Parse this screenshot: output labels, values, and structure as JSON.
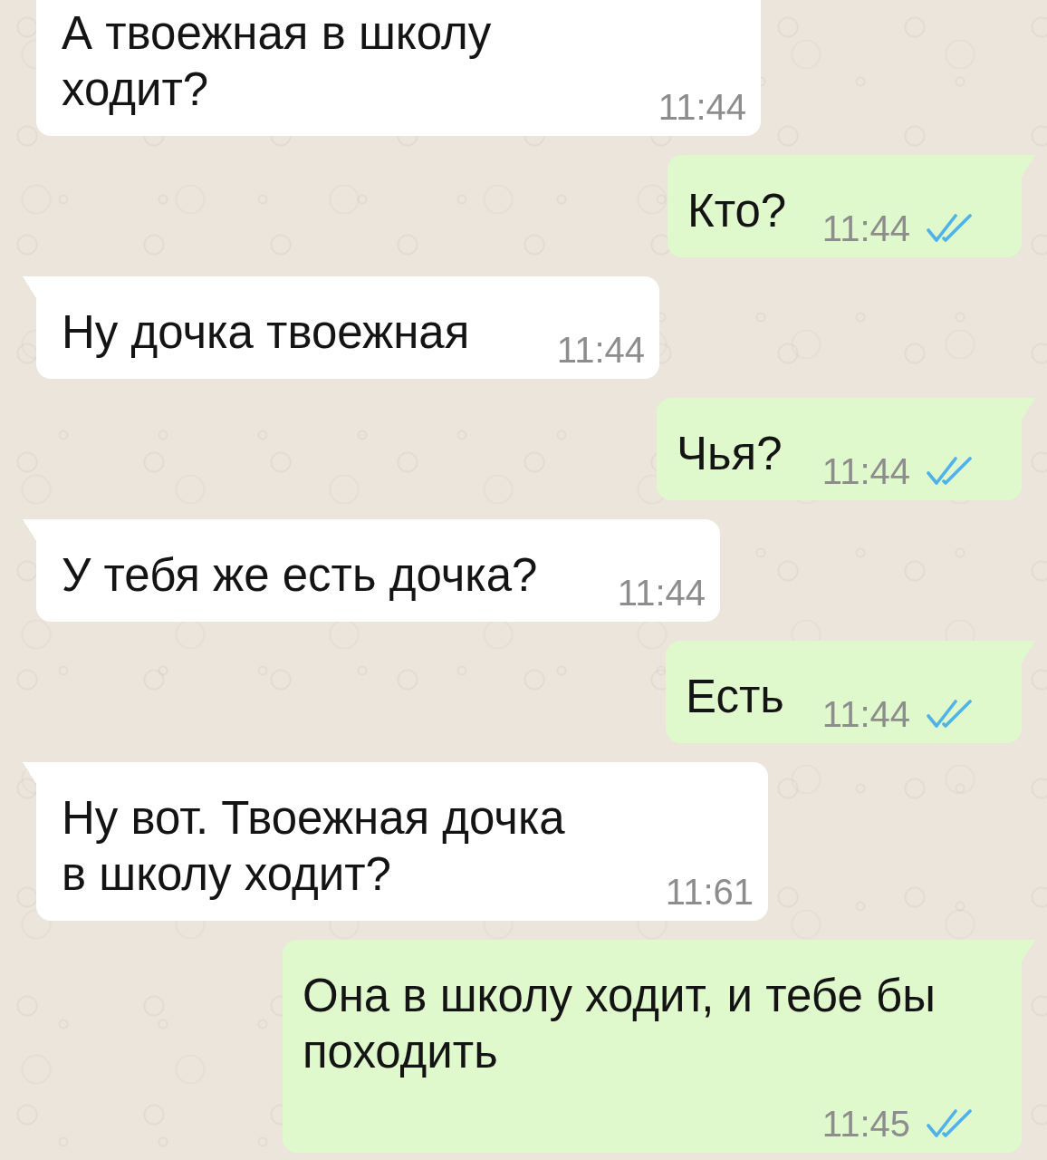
{
  "messages": [
    {
      "kind": "incoming",
      "text": "А твоежная в школу\nходит?",
      "time": "11:44"
    },
    {
      "kind": "outgoing",
      "tail": true,
      "text": "Кто?",
      "time": "11:44",
      "read": true
    },
    {
      "kind": "incoming",
      "tail": true,
      "text": "Ну дочка твоежная",
      "time": "11:44"
    },
    {
      "kind": "outgoing",
      "tail": true,
      "text": "Чья?",
      "time": "11:44",
      "read": true
    },
    {
      "kind": "incoming",
      "tail": true,
      "text": "У тебя же есть дочка?",
      "time": "11:44"
    },
    {
      "kind": "outgoing",
      "tail": true,
      "text": "Есть",
      "time": "11:44",
      "read": true
    },
    {
      "kind": "incoming",
      "tail": true,
      "text": "Ну вот. Твоежная дочка\nв школу ходит?",
      "time": "11:61"
    },
    {
      "kind": "outgoing",
      "tail": true,
      "text": "Она в школу ходит, и тебе бы\nпоходить",
      "time": "11:45",
      "read": true
    }
  ]
}
